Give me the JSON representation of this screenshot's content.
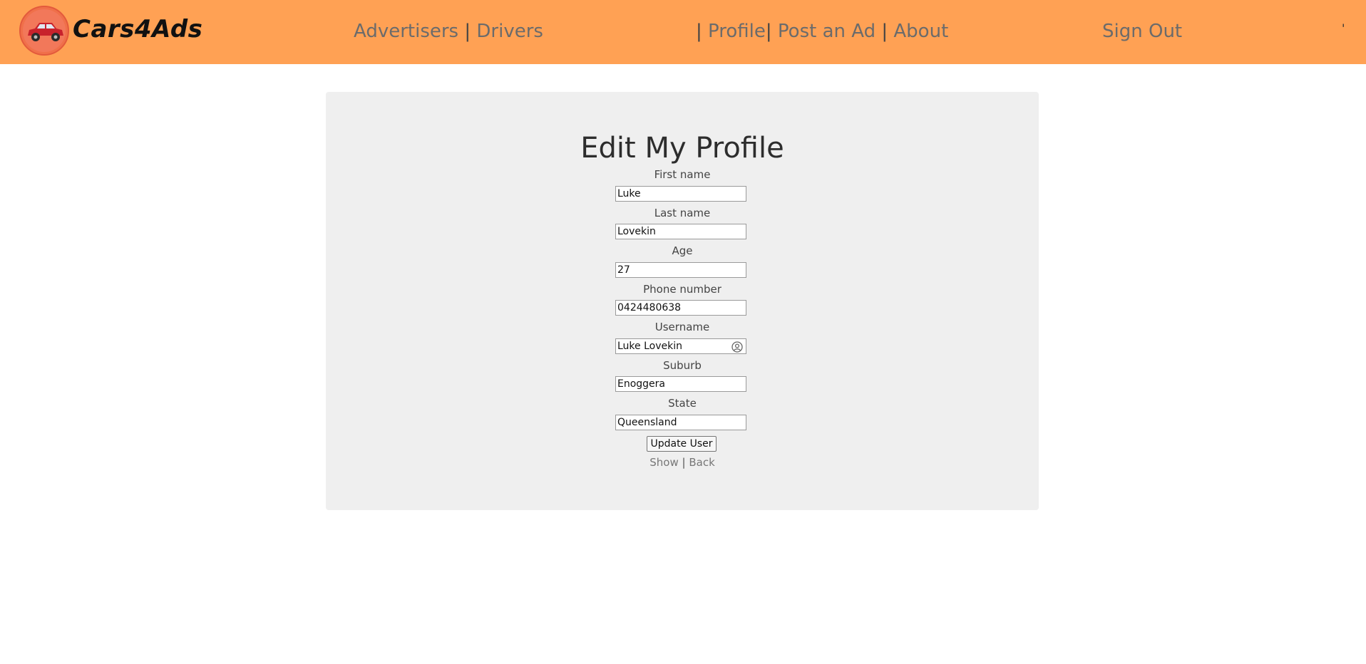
{
  "navbar": {
    "brand": "Cars4Ads",
    "links_left": [
      "Advertisers",
      "Drivers"
    ],
    "links_mid": [
      "Profile",
      "Post an Ad",
      "About"
    ],
    "sign_out": "Sign Out",
    "separator": "|",
    "stray_mark": "'",
    "background_color": "#ffa154"
  },
  "form": {
    "title": "Edit My Profile",
    "fields": [
      {
        "label": "First name",
        "value": "Luke"
      },
      {
        "label": "Last name",
        "value": "Lovekin"
      },
      {
        "label": "Age",
        "value": "27"
      },
      {
        "label": "Phone number",
        "value": "0424480638"
      },
      {
        "label": "Username",
        "value": "Luke Lovekin"
      },
      {
        "label": "Suburb",
        "value": "Enoggera"
      },
      {
        "label": "State",
        "value": "Queensland"
      }
    ],
    "submit_label": "Update User",
    "links": {
      "show": "Show",
      "back": "Back"
    }
  }
}
